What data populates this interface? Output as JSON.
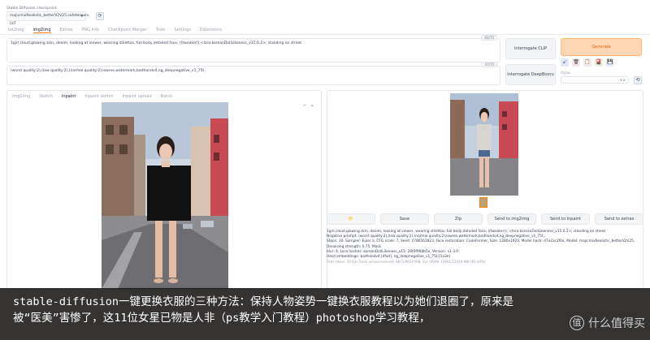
{
  "header": {
    "checkpoint_label": "Stable Diffusion checkpoint",
    "checkpoint_value": "majicmixRealistic_betterV2V25.safetensors [d7",
    "refresh_icon": "refresh-icon"
  },
  "main_tabs": [
    "txt2img",
    "img2img",
    "Extras",
    "PNG Info",
    "Checkpoint Merger",
    "Train",
    "Settings",
    "Extensions"
  ],
  "prompt": {
    "positive": "1girl,cloud,glowing skin, denim, looking at viewer, wearing stilettos, full body,detailed face, ((tweater)),<lora:koreanDollLikeness_v15:0.2>, standing on street",
    "positive_count": "61/75",
    "negative": "(worst quality:2),(low quality:2),(normal quality:2),lowres,watermark,badhandv4,ng_deepnegative_v1_75t,",
    "negative_count": "37/75"
  },
  "buttons": {
    "interrogate_clip": "Interrogate CLIP",
    "interrogate_deepbooru": "Interrogate DeepBooru",
    "generate": "Generate"
  },
  "tools": [
    "↙",
    "🗑",
    "📋",
    "🎴",
    "💾"
  ],
  "styles": {
    "label": "Styles",
    "value": "▾ ✕"
  },
  "sub_tabs": [
    "img2img",
    "Sketch",
    "Inpaint",
    "Inpaint sketch",
    "Inpaint upload",
    "Batch"
  ],
  "canvas_controls": [
    "↶",
    "✕"
  ],
  "action_buttons": [
    "📁",
    "Save",
    "Zip",
    "Send to img2img",
    "Send to inpaint",
    "Send to extras"
  ],
  "info": {
    "line1": "1girl,cloud,glowing skin, denim, looking at viewer, wearing stilettos, full body,detailed face, ((tweater)), <lora:koreanDollLikeness_v15:0.2>, standing on street",
    "line2": "Negative prompt: (worst quality:2),(low quality:2),(normal quality:2),lowres,watermark,badhandv4,ng_deepnegative_v1_75t,",
    "line3": "Steps: 30, Sampler: Euler a, CFG scale: 7, Seed: 2786561823, Face restoration: CodeFormer, Size: 1280x1920, Model hash: d7e2ac2f6a, Model: majicmixRealistic_betterV2V25, Denoising strength: 0.75, Mask",
    "line4": "blur: 4, Lora hashes: koreanDollLikeness_v15: 26f0f998b5e, Version: v1.3.0",
    "line5": "Used embeddings: badhandv4 [dfad], ng_deepnegative_v1_75t [1a3e]",
    "time": "Time taken: 20.63s  Torch active/reserved: 8871/9614 MiB, Sys VRAM: 10091/12029 MiB (82.94%)"
  },
  "caption": {
    "line1": "stable-diffusion一键更换衣服的三种方法：保持人物姿势一键换衣服教程以为她们退圈了，原来是",
    "line2": "被“医美”害惨了，这11位女星已物是人非（ps教学入门教程）photoshop学习教程，"
  },
  "watermark": {
    "logo": "值",
    "text": "什么值得买"
  }
}
